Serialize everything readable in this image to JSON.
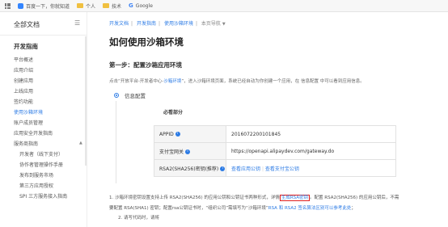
{
  "bookmarks": {
    "apps_icon": "apps-grid-icon",
    "items": [
      {
        "label": "百度一下，你就知道",
        "icon": "baidu-icon",
        "color": "#3385ff"
      },
      {
        "label": "个人",
        "icon": "folder-icon",
        "color": "#f0c040"
      },
      {
        "label": "技术",
        "icon": "folder-icon",
        "color": "#f0c040"
      },
      {
        "label": "Google",
        "icon": "google-icon",
        "color": "#4285f4"
      }
    ]
  },
  "sidebar": {
    "title": "全部文档",
    "menu_icon": "hamburger-icon",
    "section": "开发指南",
    "items": [
      {
        "label": "平台概述",
        "active": false
      },
      {
        "label": "应用介绍",
        "active": false
      },
      {
        "label": "创建应用",
        "active": false
      },
      {
        "label": "上线应用",
        "active": false
      },
      {
        "label": "签约功能",
        "active": false
      },
      {
        "label": "使用沙箱环境",
        "active": true
      },
      {
        "label": "账户成员管理",
        "active": false
      },
      {
        "label": "应用安全开发指南",
        "active": false
      },
      {
        "label": "服务商指南",
        "active": false,
        "expandable": true
      }
    ],
    "sub_items": [
      {
        "label": "开发者（线下支付）"
      },
      {
        "label": "协作者管理操作手册"
      },
      {
        "label": "发布到服务市场"
      },
      {
        "label": "第三方应用授权"
      },
      {
        "label": "SPI 三方服务接入指南"
      }
    ]
  },
  "breadcrumb": {
    "items": [
      "开发文档",
      "开发指南",
      "使用沙箱环境"
    ],
    "current": "本页导航"
  },
  "main": {
    "title": "如何使用沙箱环境",
    "step_title": "第一步：配置沙箱应用环境",
    "desc_prefix": "点击“开放平台-开发者中心-",
    "desc_link": "沙箱环境",
    "desc_suffix": "”，进入沙箱环境页面，系统已经自动为你创建一个应用，在 信息配置 中可以看到应用信息。",
    "info_label": "信息配置",
    "must_label": "必看部分",
    "rows": [
      {
        "key": "APPID",
        "value": "2016072200101845"
      },
      {
        "key": "支付宝网关",
        "value": "https://openapi.alipaydev.com/gateway.do"
      },
      {
        "key": "RSA2(SHA256)密钥(推荐)",
        "link1": "查看应用公钥",
        "link2": "查看支付宝公钥"
      }
    ],
    "note1_prefix": "1. 沙箱环境密钥设置支持上传 RSA2(SHA256) 的应用公钥和公钥证书两种形式，详情",
    "note1_highlight": "生成RSA密钥",
    "note1_suffix": "。配置 RSA2(SHA256) 的应用公钥后，不需",
    "note1b_prefix": "要配置 RSA(SHA1) 密钥；配置rsa公钥证书时，“组织公司”需填写为“沙箱环境”",
    "note1b_link": "RSA 和 RSA2 签名算法区别可以参考此处",
    "note1b_suffix": "；",
    "note2": "2. 请写代码时，请将"
  }
}
